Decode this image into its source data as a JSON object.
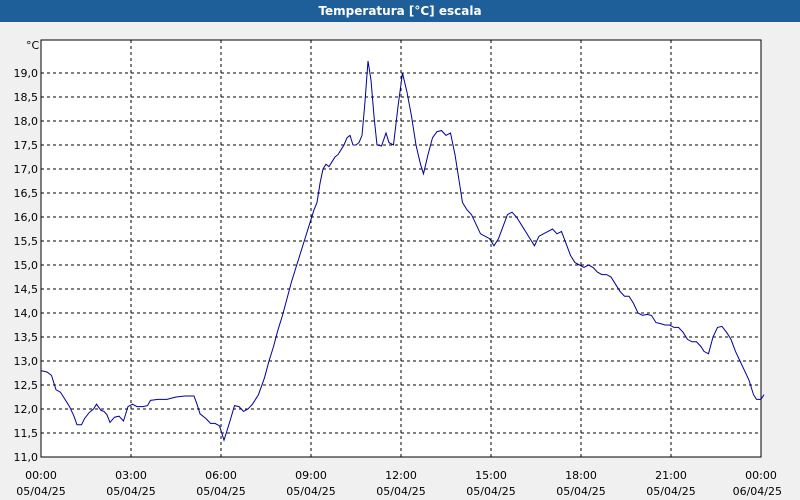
{
  "window": {
    "title": "Temperatura [°C] escala"
  },
  "chart_data": {
    "type": "line",
    "title": "Temperatura [°C] escala",
    "ylabel": "°C",
    "xlabel": "",
    "ylim": [
      11.0,
      19.25
    ],
    "y_ticks": [
      "11,0",
      "11,5",
      "12,0",
      "12,5",
      "13,0",
      "13,5",
      "14,0",
      "14,5",
      "15,0",
      "15,5",
      "16,0",
      "16,5",
      "17,0",
      "17,5",
      "18,0",
      "18,5",
      "19,0"
    ],
    "xlim": [
      0,
      24
    ],
    "x_ticks": [
      {
        "time": "00:00",
        "date": "05/04/25",
        "h": 0
      },
      {
        "time": "03:00",
        "date": "05/04/25",
        "h": 3
      },
      {
        "time": "06:00",
        "date": "05/04/25",
        "h": 6
      },
      {
        "time": "09:00",
        "date": "05/04/25",
        "h": 9
      },
      {
        "time": "12:00",
        "date": "05/04/25",
        "h": 12
      },
      {
        "time": "15:00",
        "date": "05/04/25",
        "h": 15
      },
      {
        "time": "18:00",
        "date": "05/04/25",
        "h": 18
      },
      {
        "time": "21:00",
        "date": "05/04/25",
        "h": 21
      },
      {
        "time": "00:00",
        "date": "06/04/25",
        "h": 24
      }
    ],
    "grid": true,
    "line_color": "#000099",
    "series": [
      {
        "points": [
          [
            0.0,
            12.8
          ],
          [
            0.2,
            12.77
          ],
          [
            0.35,
            12.7
          ],
          [
            0.5,
            12.4
          ],
          [
            0.65,
            12.35
          ],
          [
            0.8,
            12.2
          ],
          [
            0.95,
            12.05
          ],
          [
            1.1,
            11.85
          ],
          [
            1.2,
            11.67
          ],
          [
            1.35,
            11.67
          ],
          [
            1.45,
            11.8
          ],
          [
            1.6,
            11.92
          ],
          [
            1.75,
            12.0
          ],
          [
            1.85,
            12.1
          ],
          [
            2.0,
            11.97
          ],
          [
            2.1,
            11.95
          ],
          [
            2.2,
            11.88
          ],
          [
            2.3,
            11.72
          ],
          [
            2.45,
            11.83
          ],
          [
            2.6,
            11.85
          ],
          [
            2.75,
            11.75
          ],
          [
            2.9,
            12.05
          ],
          [
            3.05,
            12.1
          ],
          [
            3.2,
            12.05
          ],
          [
            3.4,
            12.05
          ],
          [
            3.55,
            12.07
          ],
          [
            3.65,
            12.18
          ],
          [
            3.9,
            12.2
          ],
          [
            4.2,
            12.2
          ],
          [
            4.5,
            12.25
          ],
          [
            4.8,
            12.27
          ],
          [
            5.1,
            12.27
          ],
          [
            5.2,
            12.1
          ],
          [
            5.3,
            11.9
          ],
          [
            5.5,
            11.8
          ],
          [
            5.65,
            11.7
          ],
          [
            5.8,
            11.7
          ],
          [
            5.95,
            11.65
          ],
          [
            6.1,
            11.35
          ],
          [
            6.3,
            11.75
          ],
          [
            6.45,
            12.07
          ],
          [
            6.6,
            12.05
          ],
          [
            6.75,
            11.95
          ],
          [
            6.9,
            12.0
          ],
          [
            7.05,
            12.1
          ],
          [
            7.25,
            12.3
          ],
          [
            7.45,
            12.65
          ],
          [
            7.6,
            13.0
          ],
          [
            7.75,
            13.3
          ],
          [
            7.9,
            13.65
          ],
          [
            8.05,
            13.95
          ],
          [
            8.2,
            14.3
          ],
          [
            8.35,
            14.65
          ],
          [
            8.5,
            14.95
          ],
          [
            8.65,
            15.25
          ],
          [
            8.8,
            15.55
          ],
          [
            8.95,
            15.85
          ],
          [
            9.1,
            16.15
          ],
          [
            9.2,
            16.3
          ],
          [
            9.3,
            16.7
          ],
          [
            9.4,
            17.0
          ],
          [
            9.5,
            17.1
          ],
          [
            9.6,
            17.05
          ],
          [
            9.7,
            17.15
          ],
          [
            9.8,
            17.25
          ],
          [
            9.9,
            17.3
          ],
          [
            10.0,
            17.4
          ],
          [
            10.1,
            17.5
          ],
          [
            10.2,
            17.65
          ],
          [
            10.3,
            17.7
          ],
          [
            10.4,
            17.5
          ],
          [
            10.5,
            17.5
          ],
          [
            10.6,
            17.55
          ],
          [
            10.7,
            17.7
          ],
          [
            10.8,
            18.4
          ],
          [
            10.9,
            19.25
          ],
          [
            11.0,
            18.85
          ],
          [
            11.1,
            18.1
          ],
          [
            11.2,
            17.5
          ],
          [
            11.35,
            17.48
          ],
          [
            11.5,
            17.75
          ],
          [
            11.6,
            17.55
          ],
          [
            11.75,
            17.5
          ],
          [
            11.9,
            18.3
          ],
          [
            12.05,
            19.0
          ],
          [
            12.2,
            18.6
          ],
          [
            12.35,
            18.1
          ],
          [
            12.5,
            17.5
          ],
          [
            12.65,
            17.1
          ],
          [
            12.75,
            16.9
          ],
          [
            12.9,
            17.3
          ],
          [
            13.05,
            17.65
          ],
          [
            13.2,
            17.78
          ],
          [
            13.35,
            17.8
          ],
          [
            13.5,
            17.7
          ],
          [
            13.65,
            17.75
          ],
          [
            13.8,
            17.3
          ],
          [
            13.95,
            16.7
          ],
          [
            14.05,
            16.3
          ],
          [
            14.2,
            16.15
          ],
          [
            14.35,
            16.05
          ],
          [
            14.5,
            15.85
          ],
          [
            14.65,
            15.65
          ],
          [
            14.8,
            15.6
          ],
          [
            14.95,
            15.55
          ],
          [
            15.1,
            15.4
          ],
          [
            15.25,
            15.55
          ],
          [
            15.4,
            15.8
          ],
          [
            15.55,
            16.05
          ],
          [
            15.7,
            16.1
          ],
          [
            15.85,
            16.0
          ],
          [
            16.0,
            15.85
          ],
          [
            16.15,
            15.7
          ],
          [
            16.3,
            15.55
          ],
          [
            16.45,
            15.4
          ],
          [
            16.6,
            15.6
          ],
          [
            16.75,
            15.65
          ],
          [
            16.9,
            15.7
          ],
          [
            17.05,
            15.75
          ],
          [
            17.2,
            15.65
          ],
          [
            17.35,
            15.7
          ],
          [
            17.5,
            15.45
          ],
          [
            17.65,
            15.2
          ],
          [
            17.8,
            15.05
          ],
          [
            17.95,
            15.0
          ],
          [
            18.1,
            14.95
          ],
          [
            18.25,
            15.0
          ],
          [
            18.4,
            14.95
          ],
          [
            18.55,
            14.85
          ],
          [
            18.7,
            14.8
          ],
          [
            18.85,
            14.8
          ],
          [
            19.0,
            14.75
          ],
          [
            19.15,
            14.6
          ],
          [
            19.3,
            14.45
          ],
          [
            19.45,
            14.35
          ],
          [
            19.6,
            14.35
          ],
          [
            19.75,
            14.2
          ],
          [
            19.9,
            14.0
          ],
          [
            20.05,
            13.95
          ],
          [
            20.2,
            13.97
          ],
          [
            20.35,
            13.95
          ],
          [
            20.5,
            13.8
          ],
          [
            20.65,
            13.78
          ],
          [
            20.8,
            13.75
          ],
          [
            20.95,
            13.75
          ],
          [
            21.1,
            13.7
          ],
          [
            21.25,
            13.7
          ],
          [
            21.4,
            13.6
          ],
          [
            21.55,
            13.45
          ],
          [
            21.7,
            13.4
          ],
          [
            21.85,
            13.4
          ],
          [
            22.0,
            13.3
          ],
          [
            22.1,
            13.2
          ],
          [
            22.25,
            13.15
          ],
          [
            22.4,
            13.5
          ],
          [
            22.55,
            13.7
          ],
          [
            22.7,
            13.72
          ],
          [
            22.85,
            13.6
          ],
          [
            23.0,
            13.45
          ],
          [
            23.15,
            13.2
          ],
          [
            23.3,
            13.0
          ],
          [
            23.45,
            12.8
          ],
          [
            23.6,
            12.6
          ],
          [
            23.75,
            12.3
          ],
          [
            23.85,
            12.2
          ],
          [
            24.0,
            12.2
          ],
          [
            24.1,
            12.3
          ]
        ]
      }
    ]
  }
}
